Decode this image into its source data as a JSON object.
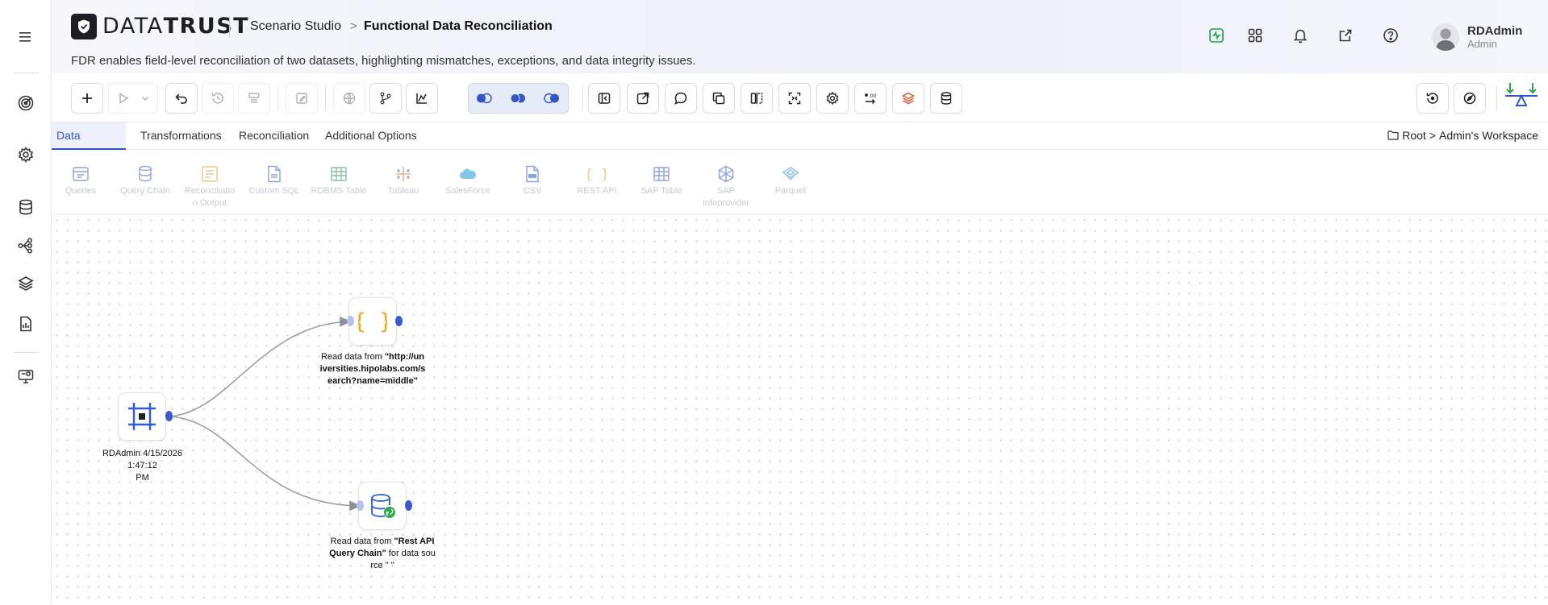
{
  "app": {
    "logo_text_light": "DATA",
    "logo_text_bold": "TRUST"
  },
  "header": {
    "breadcrumb_parent": "Scenario Studio",
    "breadcrumb_sep": ">",
    "breadcrumb_current": "Functional Data Reconciliation",
    "subtitle": "FDR enables field-level reconciliation of two datasets, highlighting mismatches, exceptions, and data integrity issues.",
    "icons": [
      "activity-icon",
      "apps-grid-icon",
      "bell-icon",
      "external-link-icon",
      "help-icon"
    ]
  },
  "user": {
    "name": "RDAdmin",
    "role": "Admin"
  },
  "sidebar": {
    "icons": [
      "menu-icon",
      "target-icon",
      "settings-icon",
      "database-icon",
      "flow-icon",
      "layers-icon",
      "report-icon",
      "monitor-icon"
    ]
  },
  "tabs": [
    {
      "label": "Data Sources",
      "active": true
    },
    {
      "label": "Transformations",
      "active": false
    },
    {
      "label": "Reconciliation",
      "active": false
    },
    {
      "label": "Additional Options",
      "active": false
    }
  ],
  "workspace": {
    "root": "Root",
    "sep": ">",
    "name": "Admin's Workspace"
  },
  "palette": [
    {
      "label": "Queries",
      "icon": "queries-icon"
    },
    {
      "label": "Query Chain",
      "icon": "query-chain-icon"
    },
    {
      "label": "Reconciliation Output",
      "icon": "recon-output-icon"
    },
    {
      "label": "Custom SQL",
      "icon": "custom-sql-icon"
    },
    {
      "label": "RDBMS Table",
      "icon": "rdbms-table-icon"
    },
    {
      "label": "Tableau",
      "icon": "tableau-icon"
    },
    {
      "label": "SalesForce",
      "icon": "salesforce-icon"
    },
    {
      "label": "CSV",
      "icon": "csv-icon"
    },
    {
      "label": "REST API",
      "icon": "rest-api-icon"
    },
    {
      "label": "SAP Table",
      "icon": "sap-table-icon"
    },
    {
      "label": "SAP Infoprovider",
      "icon": "sap-infoprovider-icon"
    },
    {
      "label": "Parquet",
      "icon": "parquet-icon"
    }
  ],
  "palette_labels_wrapped": {
    "recon_line1": "Reconciliatio",
    "recon_line2": "n Output",
    "sap_line1": "SAP",
    "sap_line2": "Infoprovider"
  },
  "canvas": {
    "start_node": {
      "label_line1": "RDAdmin 4/15/2026 1:47:12",
      "label_line2": "PM"
    },
    "rest_node": {
      "prefix": "Read data from ",
      "line1": "\"http://un",
      "line2": "iversities.hipolabs.com/s",
      "line3": "earch?name=middle\""
    },
    "chain_node": {
      "prefix": "Read data from ",
      "bold1": "\"Rest API",
      "bold2": "Query Chain\"",
      "suffix": " for data sou",
      "line3": "rce \" \""
    }
  },
  "colors": {
    "accent": "#3557c8",
    "port_out": "#3d59d1",
    "port_in": "#b7c2ea",
    "rest_icon": "#f2a713",
    "start_icon": "#2e5bd8",
    "activity_green": "#22a245"
  }
}
